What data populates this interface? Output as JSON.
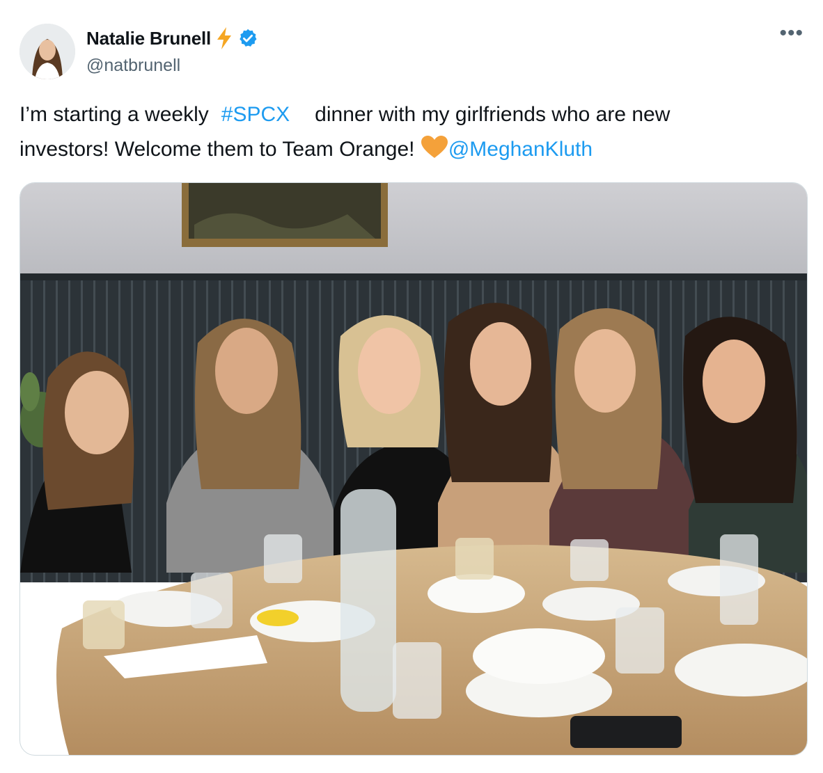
{
  "author": {
    "name": "Natalie Brunell",
    "handle": "@natbrunell",
    "verified": true,
    "emoji": "lightning-icon"
  },
  "tweet": {
    "line1_before": "I’m starting a weekly",
    "hashtag": "#SPCX",
    "line1_after": "dinner with my girlfriends who are new",
    "line2_before": "investors! Welcome them to Team Orange!",
    "mention": "@MeghanKluth",
    "heart_color": "#f7a23b"
  },
  "photo": {
    "subject": "six women seated at a round wooden restaurant table with glasses and plates"
  },
  "colors": {
    "link": "#1d9bf0",
    "verified": "#1d9bf0",
    "text": "#0f1419",
    "secondary": "#536471"
  }
}
